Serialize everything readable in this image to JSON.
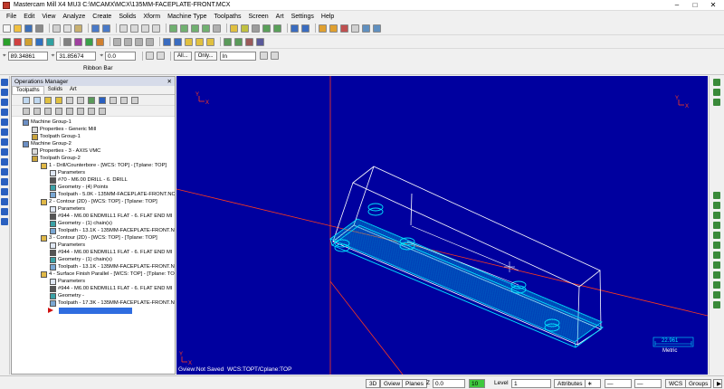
{
  "titlebar": {
    "text": "Mastercam Mill X4 MU3  C:\\MCAMX\\MCX\\135MM-FACEPLATE-FRONT.MCX"
  },
  "menu": [
    "File",
    "Edit",
    "View",
    "Analyze",
    "Create",
    "Solids",
    "Xform",
    "Machine Type",
    "Toolpaths",
    "Screen",
    "Art",
    "Settings",
    "Help"
  ],
  "coords": {
    "x": "89.34861",
    "y": "31.85674",
    "z": "0.0",
    "all_label": "All...",
    "only_label": "Only...",
    "in_value": "In"
  },
  "ribbonbar": {
    "label": "Ribbon Bar"
  },
  "ops": {
    "title": "Operations Manager",
    "tabs": [
      "Toolpaths",
      "Solids",
      "Art"
    ],
    "tree": [
      {
        "text": "Machine Group-1",
        "icon": "mach"
      },
      {
        "text": "Properties - Generic Mill",
        "icon": "prop"
      },
      {
        "text": "Toolpath Group-1",
        "icon": "tp"
      },
      {
        "text": "Machine Group-2",
        "icon": "mach"
      },
      {
        "text": "Properties - 3 - AXIS VMC",
        "icon": "prop"
      },
      {
        "text": "Toolpath Group-2",
        "icon": "tp"
      },
      {
        "text": "1 - Drill/Counterbore - [WCS: TOP] - [Tplane: TOP]",
        "icon": "folder"
      },
      {
        "text": "Parameters",
        "icon": "param"
      },
      {
        "text": "#70 - M6.00 DRILL  -  6. DRILL",
        "icon": "tool"
      },
      {
        "text": "Geometry - (4) Points",
        "icon": "geo"
      },
      {
        "text": "Toolpath - 5.0K - 135MM-FACEPLATE-FRONT.NC",
        "icon": "path"
      },
      {
        "text": "2 - Contour (2D) - [WCS: TOP] - [Tplane: TOP]",
        "icon": "folder"
      },
      {
        "text": "Parameters",
        "icon": "param"
      },
      {
        "text": "#944 - M6.00 ENDMILL1 FLAT - 6. FLAT END MI",
        "icon": "tool"
      },
      {
        "text": "Geometry - (1) chain(s)",
        "icon": "geo"
      },
      {
        "text": "Toolpath - 13.1K - 135MM-FACEPLATE-FRONT.N",
        "icon": "path"
      },
      {
        "text": "3 - Contour (2D) - [WCS: TOP] - [Tplane: TOP]",
        "icon": "folder"
      },
      {
        "text": "Parameters",
        "icon": "param"
      },
      {
        "text": "#944 - M6.00 ENDMILL1 FLAT - 6. FLAT END MI",
        "icon": "tool"
      },
      {
        "text": "Geometry - (1) chain(s)",
        "icon": "geo"
      },
      {
        "text": "Toolpath - 13.1K - 135MM-FACEPLATE-FRONT.N",
        "icon": "path"
      },
      {
        "text": "4 - Surface Finish Parallel - [WCS: TOP] - [Tplane: TO",
        "icon": "folder"
      },
      {
        "text": "Parameters",
        "icon": "param"
      },
      {
        "text": "#944 - M6.00 ENDMILL1 FLAT - 6. FLAT END MI",
        "icon": "tool"
      },
      {
        "text": "Geometry -",
        "icon": "geo"
      },
      {
        "text": "Toolpath - 17.3K - 135MM-FACEPLATE-FRONT.N",
        "icon": "path"
      }
    ]
  },
  "viewport": {
    "gview": "Gview:Not Saved",
    "wcs": "WCS:TOP",
    "tcplane": "T/Cplane:TOP",
    "scale_value": "22.961",
    "scale_unit": "Metric",
    "axis_y": "Y",
    "axis_x": "X",
    "colors": {
      "bg": "#00009f",
      "part": "#00e5ff",
      "stock": "#ffffff",
      "axis": "#ff3a1a"
    }
  },
  "statusbar": {
    "view3d": "3D",
    "gview": "Gview",
    "planes": "Planes",
    "z_label": "Z",
    "z_value": "0.0",
    "color_value": "10",
    "level_label": "Level",
    "level_value": "1",
    "attributes": "Attributes",
    "wcs": "WCS",
    "groups": "Groups"
  }
}
